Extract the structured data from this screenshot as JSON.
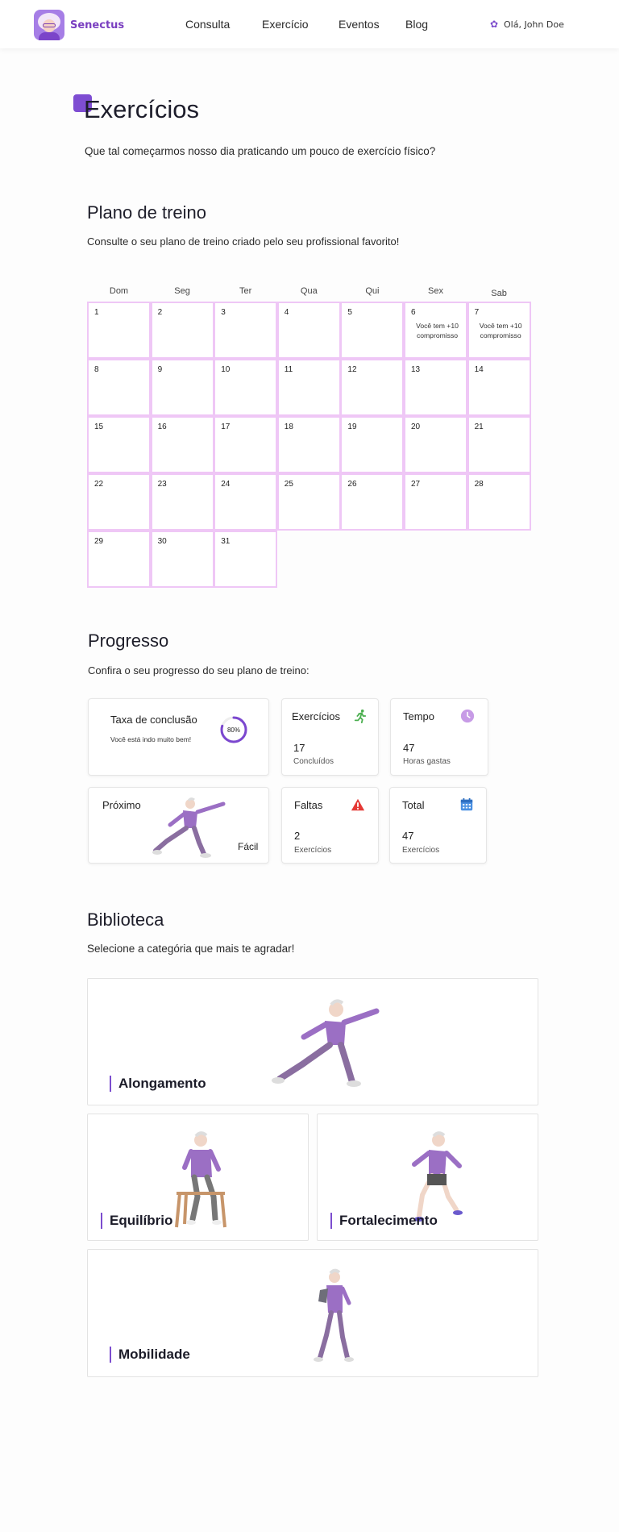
{
  "header": {
    "brand": "Senectus",
    "nav": [
      "Consulta",
      "Exercício",
      "Eventos",
      "Blog"
    ],
    "greeting": "Olá, John Doe",
    "accent_color": "#7c4dcf"
  },
  "page": {
    "title": "Exercícios",
    "subtitle": "Que tal começarmos nosso dia praticando um pouco de exercício físico?"
  },
  "plan": {
    "title": "Plano de treino",
    "subtitle": "Consulte o seu plano de treino criado pelo seu profissional favorito!",
    "weekdays": [
      "Dom",
      "Seg",
      "Ter",
      "Qua",
      "Qui",
      "Sex",
      "Sab"
    ],
    "days": [
      {
        "n": "1"
      },
      {
        "n": "2"
      },
      {
        "n": "3"
      },
      {
        "n": "4"
      },
      {
        "n": "5"
      },
      {
        "n": "6",
        "note": "Você tem +10 compromisso"
      },
      {
        "n": "7",
        "note": "Você tem +10 compromisso"
      },
      {
        "n": "8"
      },
      {
        "n": "9"
      },
      {
        "n": "10"
      },
      {
        "n": "11"
      },
      {
        "n": "12"
      },
      {
        "n": "13"
      },
      {
        "n": "14"
      },
      {
        "n": "15"
      },
      {
        "n": "16"
      },
      {
        "n": "17"
      },
      {
        "n": "18"
      },
      {
        "n": "19"
      },
      {
        "n": "20"
      },
      {
        "n": "21"
      },
      {
        "n": "22"
      },
      {
        "n": "23"
      },
      {
        "n": "24"
      },
      {
        "n": "25"
      },
      {
        "n": "26"
      },
      {
        "n": "27"
      },
      {
        "n": "28"
      },
      {
        "n": "29"
      },
      {
        "n": "30"
      },
      {
        "n": "31"
      }
    ]
  },
  "progress": {
    "title": "Progresso",
    "subtitle": "Confira o seu progresso do seu plano de treino:",
    "completion": {
      "title": "Taxa de conclusão",
      "message": "Você está indo muito bem!",
      "percent_label": "80%",
      "percent": 0.8
    },
    "exercises": {
      "title": "Exercícios",
      "value": "17",
      "sub": "Concluídos"
    },
    "time": {
      "title": "Tempo",
      "value": "47",
      "sub": "Horas gastas"
    },
    "next": {
      "title": "Próximo",
      "difficulty": "Fácil"
    },
    "absences": {
      "title": "Faltas",
      "value": "2",
      "sub": "Exercícios"
    },
    "total": {
      "title": "Total",
      "value": "47",
      "sub": "Exercícios"
    }
  },
  "library": {
    "title": "Biblioteca",
    "subtitle": "Selecione a categória que mais te agradar!",
    "categories": [
      "Alongamento",
      "Equilíbrio",
      "Fortalecimento",
      "Mobilidade"
    ]
  }
}
